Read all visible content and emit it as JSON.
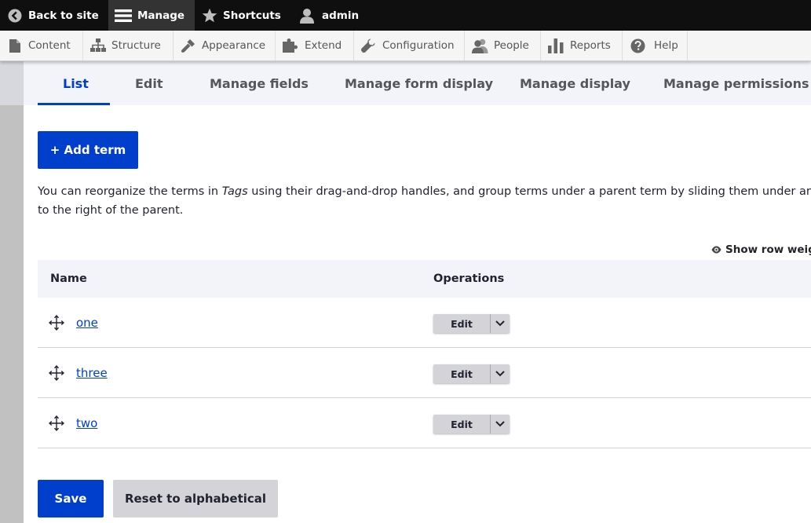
{
  "toolbar": {
    "back": "Back to site",
    "manage": "Manage",
    "shortcuts": "Shortcuts",
    "user": "admin"
  },
  "tray": {
    "items": [
      "Content",
      "Structure",
      "Appearance",
      "Extend",
      "Configuration",
      "People",
      "Reports",
      "Help"
    ]
  },
  "tabs": [
    "List",
    "Edit",
    "Manage fields",
    "Manage form display",
    "Manage display",
    "Manage permissions"
  ],
  "actions": {
    "add_term": "+ Add term"
  },
  "description": {
    "before": "You can reorganize the terms in ",
    "vocabulary": "Tags",
    "after": " using their drag-and-drop handles, and group terms under a parent term by sliding them under and to the right of the parent."
  },
  "show_weights": "Show row weigh",
  "table": {
    "headers": [
      "Name",
      "Operations"
    ],
    "rows": [
      {
        "name": "one",
        "operation": "Edit"
      },
      {
        "name": "three",
        "operation": "Edit"
      },
      {
        "name": "two",
        "operation": "Edit"
      }
    ]
  },
  "form": {
    "save": "Save",
    "reset": "Reset to alphabetical"
  },
  "colors": {
    "accent": "#003ecc",
    "toolbar_bg": "#0f0f0f",
    "header_bg": "#f3f4f9"
  }
}
